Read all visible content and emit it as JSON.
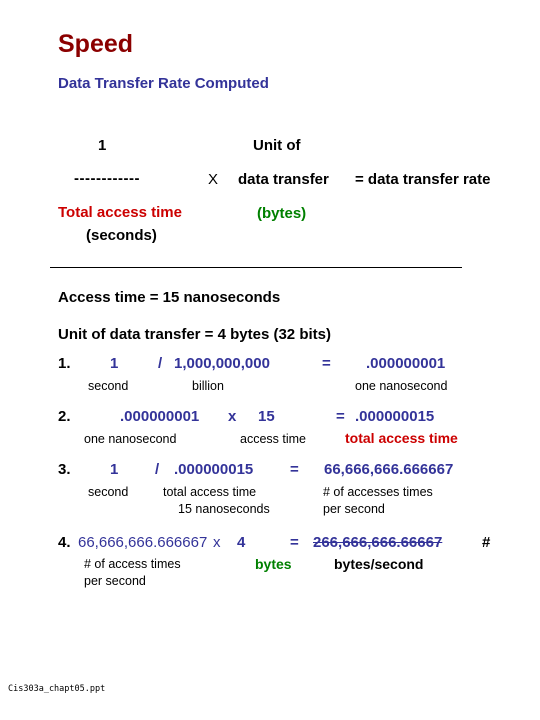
{
  "slide": {
    "title": "Speed",
    "subtitle": "Data Transfer Rate Computed",
    "title_color": "#8B0000",
    "subtitle_color": "#333399"
  },
  "formula": {
    "numerator": "1",
    "fraction_bar": "------------",
    "denominator_main": "Total access time",
    "denominator_unit": "(seconds)",
    "denominator_color": "#CC0000",
    "multiply_symbol": "X",
    "factor_line1": "Unit of",
    "factor_line2": "data transfer",
    "factor_unit": "(bytes)",
    "factor_unit_color": "#008000",
    "result": "= data transfer rate"
  },
  "givens": [
    "Access time = 15 nanoseconds",
    "Unit of data transfer = 4 bytes (32 bits)"
  ],
  "steps": [
    {
      "number": "1.",
      "operand_a": "1",
      "operator": "/",
      "operand_b": "1,000,000,000",
      "equals": "=",
      "result": ".000000001",
      "caption_a": "second",
      "caption_b": "billion",
      "caption_result": "one nanosecond"
    },
    {
      "number": "2.",
      "operand_a": ".000000001",
      "operator": "x",
      "operand_b": "15",
      "equals": "=",
      "result": ".000000015",
      "caption_a": "one nanosecond",
      "caption_b": "access time",
      "caption_result": "total access time",
      "caption_result_color": "#CC0000"
    },
    {
      "number": "3.",
      "operand_a": "1",
      "operator": "/",
      "operand_b": ".000000015",
      "equals": "=",
      "result": "66,666,666.666667",
      "caption_a": "second",
      "caption_b_line1": "total access time",
      "caption_b_line2": "15 nanoseconds",
      "caption_result_line1": "# of accesses times",
      "caption_result_line2": "per second"
    },
    {
      "number": "4.",
      "operand_a": "66,666,666.666667",
      "operator": "x",
      "operand_b": "4",
      "equals": "=",
      "result": "266,666,666.66667",
      "result_suffix": "#",
      "caption_a_line1": "# of access times",
      "caption_a_line2": "per second",
      "caption_b": "bytes",
      "caption_b_color": "#008000",
      "caption_result": "bytes/second"
    }
  ],
  "footer": {
    "filename": "Cis303a_chapt05.ppt"
  }
}
